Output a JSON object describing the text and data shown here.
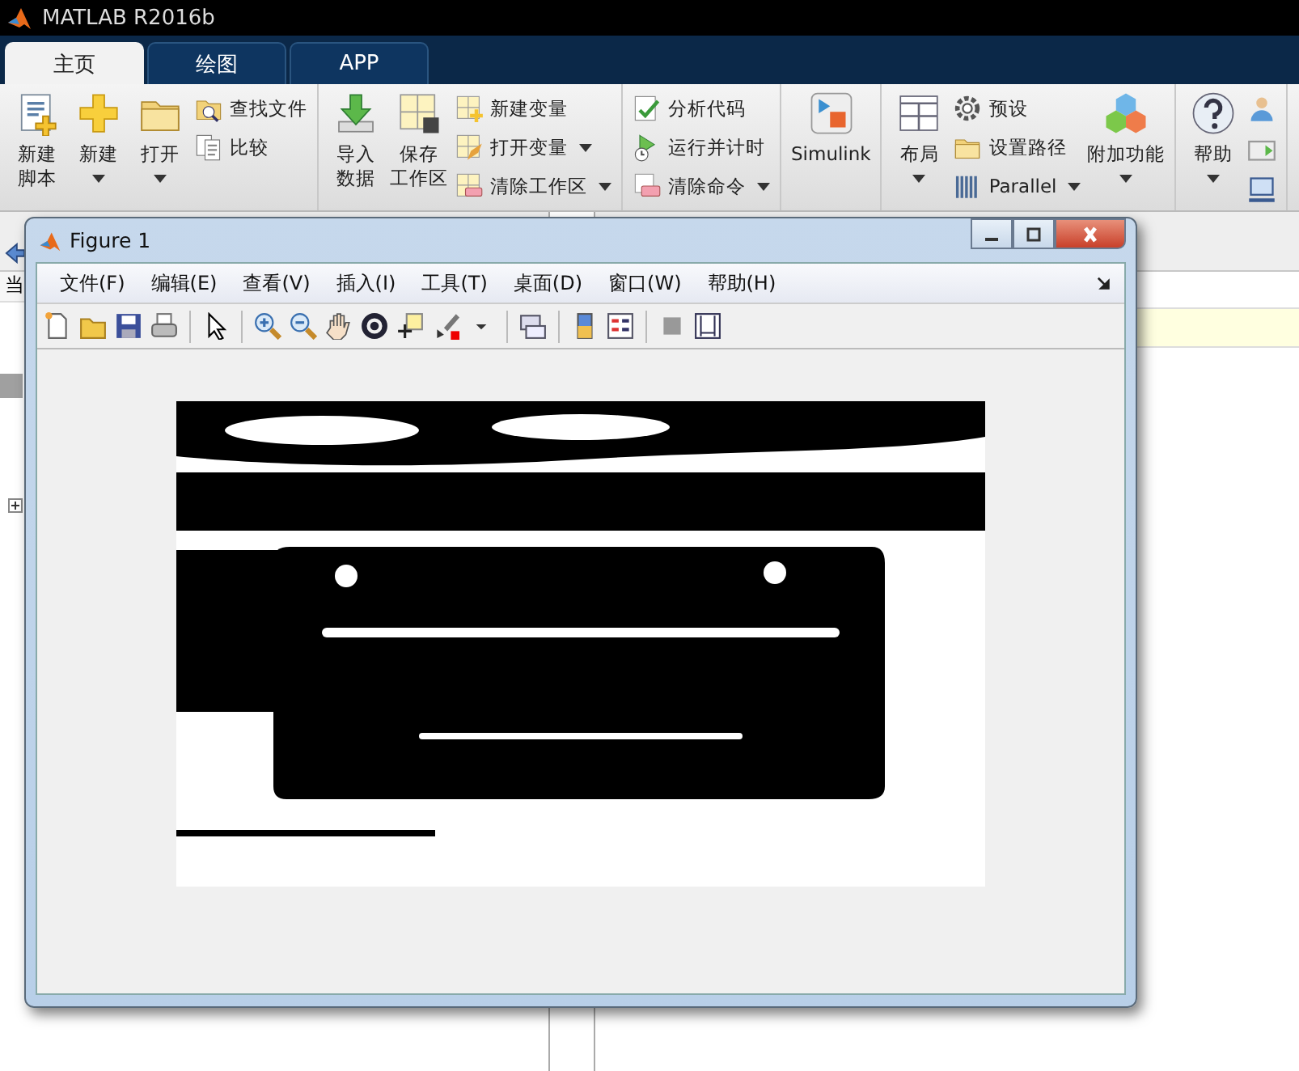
{
  "app": {
    "title": "MATLAB R2016b"
  },
  "tabs": [
    {
      "label": "主页",
      "selected": true
    },
    {
      "label": "绘图",
      "selected": false
    },
    {
      "label": "APP",
      "selected": false
    }
  ],
  "ribbon": {
    "groups": [
      {
        "items": [
          {
            "kind": "large",
            "lines": [
              "新建",
              "脚本"
            ],
            "dropdown": false
          },
          {
            "kind": "large",
            "lines": [
              "新建"
            ],
            "dropdown": true
          },
          {
            "kind": "large",
            "lines": [
              "打开"
            ],
            "dropdown": true
          },
          {
            "kind": "stack",
            "items": [
              {
                "label": "查找文件",
                "dropdown": false
              },
              {
                "label": "比较",
                "dropdown": false
              }
            ]
          }
        ]
      },
      {
        "items": [
          {
            "kind": "large",
            "lines": [
              "导入",
              "数据"
            ],
            "dropdown": false
          },
          {
            "kind": "large",
            "lines": [
              "保存",
              "工作区"
            ],
            "dropdown": false
          },
          {
            "kind": "stack",
            "items": [
              {
                "label": "新建变量",
                "dropdown": false
              },
              {
                "label": "打开变量",
                "dropdown": true
              },
              {
                "label": "清除工作区",
                "dropdown": true
              }
            ]
          }
        ]
      },
      {
        "items": [
          {
            "kind": "stack",
            "items": [
              {
                "label": "分析代码",
                "dropdown": false
              },
              {
                "label": "运行并计时",
                "dropdown": false
              },
              {
                "label": "清除命令",
                "dropdown": true
              }
            ]
          }
        ]
      },
      {
        "items": [
          {
            "kind": "large",
            "lines": [
              "Simulink"
            ],
            "dropdown": false
          }
        ]
      },
      {
        "items": [
          {
            "kind": "large",
            "lines": [
              "布局"
            ],
            "dropdown": true
          },
          {
            "kind": "stack",
            "items": [
              {
                "label": "预设",
                "dropdown": false
              },
              {
                "label": "设置路径",
                "dropdown": false
              },
              {
                "label": "Parallel",
                "dropdown": true
              }
            ]
          },
          {
            "kind": "large",
            "lines": [
              "附加功能"
            ],
            "dropdown": true
          }
        ]
      },
      {
        "items": [
          {
            "kind": "large",
            "lines": [
              "帮助"
            ],
            "dropdown": true
          },
          {
            "kind": "icon-stack"
          }
        ]
      }
    ]
  },
  "folder_panel": {
    "header": "当"
  },
  "figure": {
    "title": "Figure 1",
    "menu": [
      "文件(F)",
      "编辑(E)",
      "查看(V)",
      "插入(I)",
      "工具(T)",
      "桌面(D)",
      "窗口(W)",
      "帮助(H)"
    ]
  }
}
